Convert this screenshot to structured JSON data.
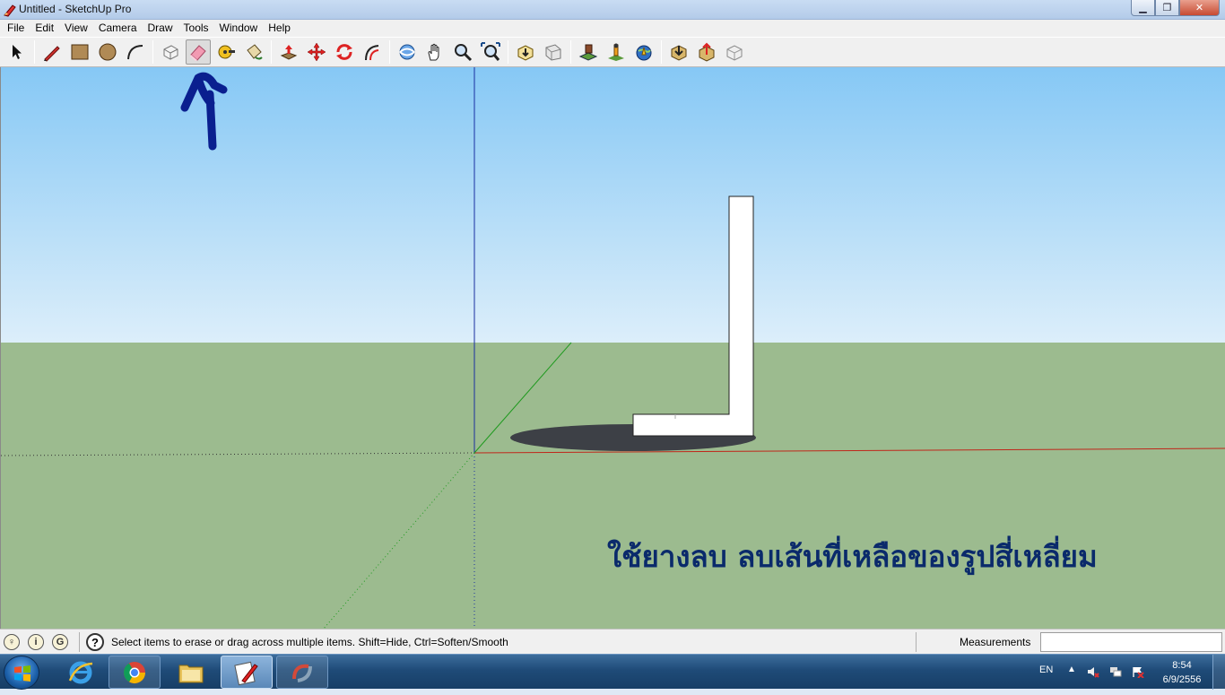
{
  "window": {
    "title": "Untitled - SketchUp Pro",
    "min_label": "▁",
    "max_label": "❐",
    "close_label": "✕"
  },
  "menu": [
    "File",
    "Edit",
    "View",
    "Camera",
    "Draw",
    "Tools",
    "Window",
    "Help"
  ],
  "toolbar": {
    "tools": [
      {
        "name": "select-icon",
        "active": false
      },
      {
        "name": "line-pencil-icon",
        "active": false
      },
      {
        "name": "rectangle-icon",
        "active": false
      },
      {
        "name": "circle-icon",
        "active": false
      },
      {
        "name": "arc-icon",
        "active": false
      },
      {
        "name": "make-component-icon",
        "active": false
      },
      {
        "name": "eraser-icon",
        "active": true
      },
      {
        "name": "tape-measure-icon",
        "active": false
      },
      {
        "name": "paint-bucket-icon",
        "active": false
      },
      {
        "name": "push-pull-icon",
        "active": false
      },
      {
        "name": "move-icon",
        "active": false
      },
      {
        "name": "rotate-icon",
        "active": false
      },
      {
        "name": "offset-icon",
        "active": false
      },
      {
        "name": "orbit-icon",
        "active": false
      },
      {
        "name": "pan-icon",
        "active": false
      },
      {
        "name": "zoom-icon",
        "active": false
      },
      {
        "name": "zoom-extents-icon",
        "active": false
      },
      {
        "name": "get-models-icon",
        "active": false
      },
      {
        "name": "share-model-icon",
        "active": false
      },
      {
        "name": "add-location-icon",
        "active": false
      },
      {
        "name": "toggle-terrain-icon",
        "active": false
      },
      {
        "name": "google-earth-icon",
        "active": false
      },
      {
        "name": "get-photo-texture-icon",
        "active": false
      },
      {
        "name": "share-component-icon",
        "active": false
      },
      {
        "name": "component-settings-icon",
        "active": false
      }
    ]
  },
  "viewport": {
    "caption": "ใช้ยางลบ ลบเส้นที่เหลือของรูปสี่เหลี่ยม",
    "sky_top": "#86c8f5",
    "sky_bottom": "#dceefa",
    "ground": "#9cbb8f",
    "annotation_color": "#0a1f8f"
  },
  "status": {
    "icons": [
      "geo-location-icon",
      "credits-icon",
      "user-account-icon"
    ],
    "help_glyph": "?",
    "text": "Select items to erase or drag across multiple items. Shift=Hide, Ctrl=Soften/Smooth",
    "measurements_label": "Measurements",
    "measurements_value": ""
  },
  "taskbar": {
    "apps": [
      "internet-explorer-icon",
      "chrome-icon",
      "file-explorer-icon",
      "sketchup-icon",
      "sketchup-layout-icon"
    ],
    "language": "EN",
    "time": "8:54",
    "date": "6/9/2556"
  }
}
